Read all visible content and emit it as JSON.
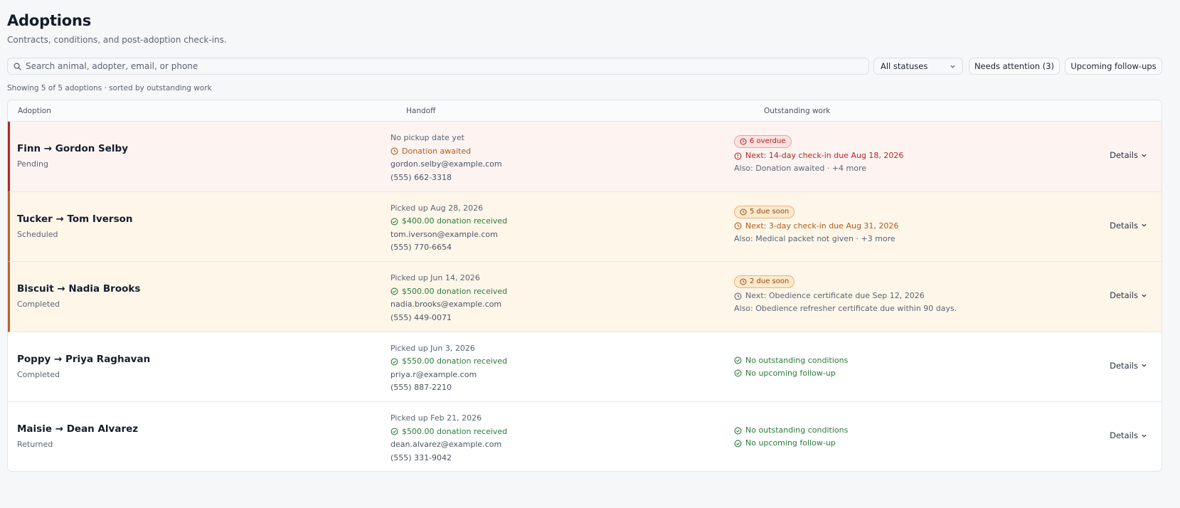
{
  "header": {
    "title": "Adoptions",
    "subtitle": "Contracts, conditions, and post-adoption check-ins."
  },
  "toolbar": {
    "search_placeholder": "Search animal, adopter, email, or phone",
    "status_select": "All statuses",
    "needs_attention": "Needs attention (3)",
    "upcoming": "Upcoming follow-ups"
  },
  "summary": "Showing 5 of 5 adoptions · sorted by outstanding work",
  "table": {
    "headers": [
      "Adoption",
      "Handoff",
      "Outstanding work"
    ],
    "details_label": "Details",
    "rows": [
      {
        "title": "Finn → Gordon Selby",
        "status": "Pending",
        "pickup": "No pickup date yet",
        "donation": "Donation awaited",
        "email": "gordon.selby@example.com",
        "phone": "(555) 662-3318",
        "badge": "6 overdue",
        "next": "Next: 14-day check-in due Aug 18, 2026",
        "also": "Also: Donation awaited · +4 more"
      },
      {
        "title": "Tucker → Tom Iverson",
        "status": "Scheduled",
        "pickup": "Picked up Aug 28, 2026",
        "donation": "$400.00 donation received",
        "email": "tom.iverson@example.com",
        "phone": "(555) 770-6654",
        "badge": "5 due soon",
        "next": "Next: 3-day check-in due Aug 31, 2026",
        "also": "Also: Medical packet not given · +3 more"
      },
      {
        "title": "Biscuit → Nadia Brooks",
        "status": "Completed",
        "pickup": "Picked up Jun 14, 2026",
        "donation": "$500.00 donation received",
        "email": "nadia.brooks@example.com",
        "phone": "(555) 449-0071",
        "badge": "2 due soon",
        "next": "Next: Obedience certificate due Sep 12, 2026",
        "also": "Also: Obedience refresher certificate due within 90 days."
      },
      {
        "title": "Poppy → Priya Raghavan",
        "status": "Completed",
        "pickup": "Picked up Jun 3, 2026",
        "donation": "$550.00 donation received",
        "email": "priya.r@example.com",
        "phone": "(555) 887-2210",
        "work1": "No outstanding conditions",
        "work2": "No upcoming follow-up"
      },
      {
        "title": "Maisie → Dean Alvarez",
        "status": "Returned",
        "pickup": "Picked up Feb 21, 2026",
        "donation": "$500.00 donation received",
        "email": "dean.alvarez@example.com",
        "phone": "(555) 331-9042",
        "work1": "No outstanding conditions",
        "work2": "No upcoming follow-up"
      }
    ]
  },
  "colors": {
    "overdue": "#b3262a",
    "due_soon": "#b6652b",
    "ok": "#2b7a3a"
  },
  "icons": [
    "search-icon",
    "chevron-down-icon",
    "clock-icon",
    "alert-circle-icon",
    "check-circle-icon"
  ]
}
